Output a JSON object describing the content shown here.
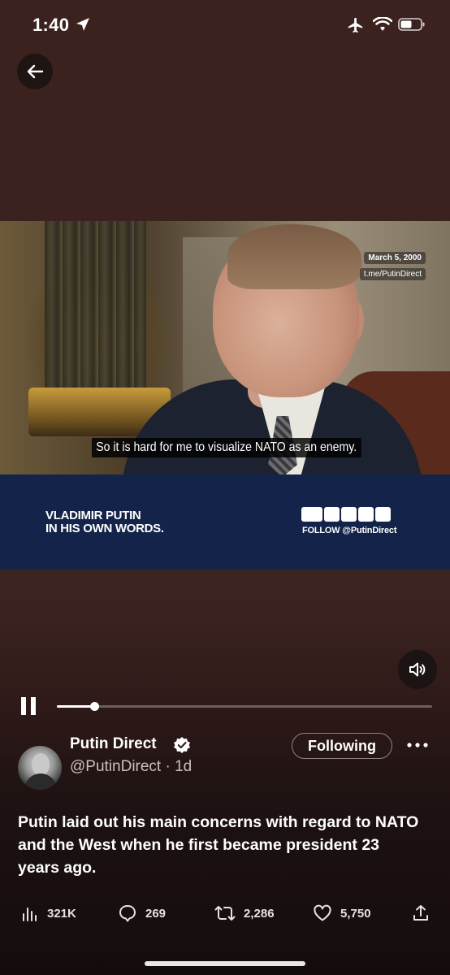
{
  "status_bar": {
    "time": "1:40"
  },
  "video": {
    "date_overlay": "March 5, 2000",
    "channel_overlay": "t.me/PutinDirect",
    "subtitle": "So it is hard for me to visualize NATO as an enemy.",
    "banner_title_line1": "VLADIMIR PUTIN",
    "banner_title_line2": "IN HIS OWN WORDS.",
    "banner_follow": "FOLLOW @PutinDirect",
    "progress_fraction": 0.1
  },
  "tweet": {
    "author_name": "Putin Direct",
    "author_handle": "@PutinDirect",
    "time_ago": "· 1d",
    "follow_label": "Following",
    "text": "Putin laid out his main concerns with regard to NATO and the West when he first became president 23 years ago."
  },
  "actions": {
    "views": "321K",
    "replies": "269",
    "retweets": "2,286",
    "likes": "5,750"
  },
  "colors": {
    "background": "#3b221f",
    "banner": "#132349"
  }
}
